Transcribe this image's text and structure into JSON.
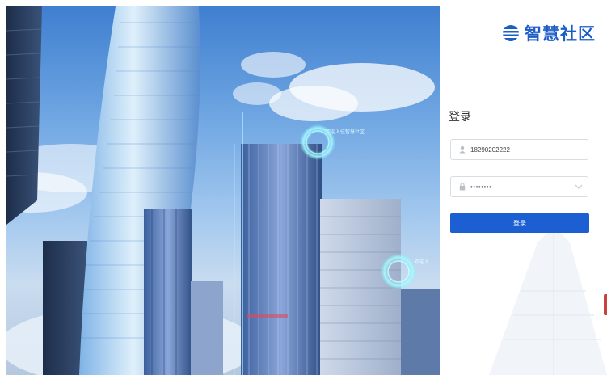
{
  "brand": {
    "name": "智慧社区",
    "logo_icon": "layered-sphere-logo-icon",
    "color": "#1d5ec6"
  },
  "hero": {
    "label_1": "欢迎入驻智慧社区",
    "label_2": "欢迎入"
  },
  "login": {
    "title": "登录",
    "username": {
      "value": "18290202222",
      "icon": "user-icon"
    },
    "password": {
      "value": "••••••••",
      "icon": "lock-icon",
      "dropdown_icon": "chevron-down-icon"
    },
    "submit_label": "登录",
    "accent": "#1b5fd2"
  }
}
